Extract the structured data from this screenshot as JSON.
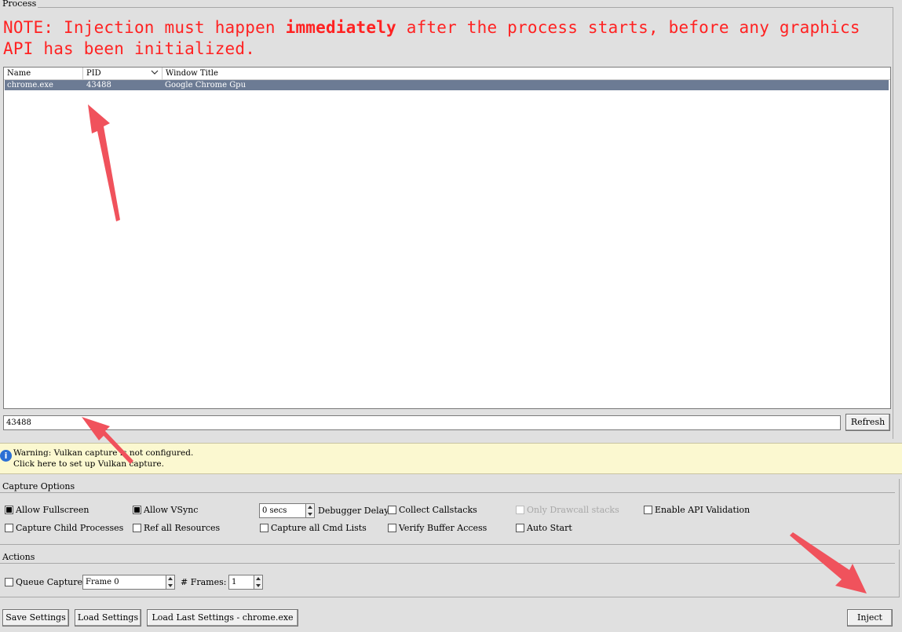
{
  "process_group": {
    "title": "Process"
  },
  "note": {
    "prefix": "NOTE: Injection must happen ",
    "emphasis": "immediately",
    "suffix": " after the process starts, before any graphics API has been initialized."
  },
  "process_table": {
    "columns": [
      "Name",
      "PID",
      "Window Title"
    ],
    "rows": [
      {
        "name": "chrome.exe",
        "pid": "43488",
        "window_title": "Google Chrome Gpu",
        "selected": true
      }
    ]
  },
  "filter": {
    "value": "43488"
  },
  "refresh_label": "Refresh",
  "warning": {
    "line1": "Warning: Vulkan capture is not configured.",
    "line2": "Click here to set up Vulkan capture."
  },
  "capture_options": {
    "title": "Capture Options",
    "allow_fullscreen": {
      "label": "Allow Fullscreen",
      "checked": true
    },
    "allow_vsync": {
      "label": "Allow VSync",
      "checked": true
    },
    "debugger_delay": {
      "value": "0 secs",
      "label": "Debugger Delay"
    },
    "collect_callstacks": {
      "label": "Collect Callstacks",
      "checked": false
    },
    "only_drawcall_stacks": {
      "label": "Only Drawcall stacks",
      "checked": false,
      "disabled": true
    },
    "enable_api_validation": {
      "label": "Enable API Validation",
      "checked": false
    },
    "capture_child_processes": {
      "label": "Capture Child Processes",
      "checked": false
    },
    "ref_all_resources": {
      "label": "Ref all Resources",
      "checked": false
    },
    "capture_all_cmd_lists": {
      "label": "Capture all Cmd Lists",
      "checked": false
    },
    "verify_buffer_access": {
      "label": "Verify Buffer Access",
      "checked": false
    },
    "auto_start": {
      "label": "Auto Start",
      "checked": false
    }
  },
  "actions": {
    "title": "Actions",
    "queue_capture": {
      "label": "Queue Capture",
      "checked": false
    },
    "frame_value": "Frame 0",
    "frames_label": "# Frames:",
    "frames_value": "1"
  },
  "buttons": {
    "save_settings": "Save Settings",
    "load_settings": "Load Settings",
    "load_last_settings": "Load Last Settings - chrome.exe",
    "inject": "Inject"
  },
  "colors": {
    "note_red": "#ff2222",
    "selection": "#6c7b94",
    "annotation_arrow": "#f0525c",
    "warning_bg": "#fbf8d0"
  }
}
